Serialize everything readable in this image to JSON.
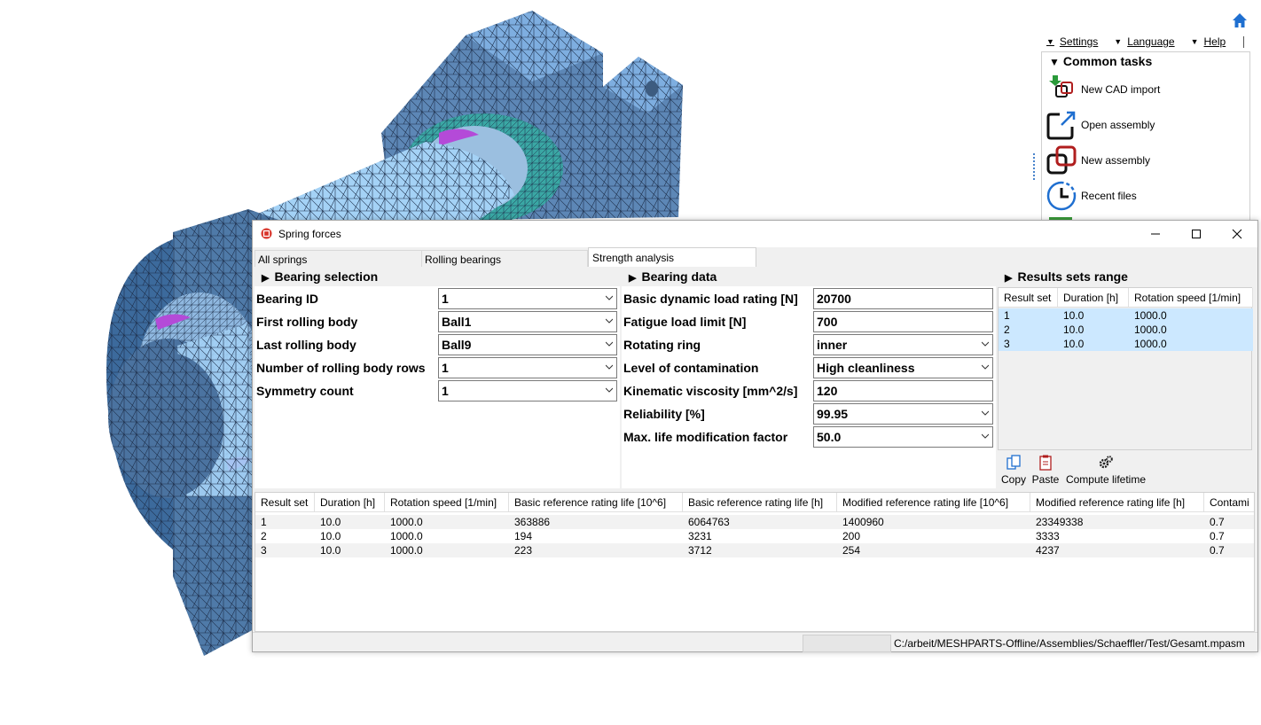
{
  "menubar": {
    "settings": "Settings",
    "language": "Language",
    "help": "Help"
  },
  "common_tasks": {
    "title": "Common tasks",
    "items": [
      "New CAD import",
      "Open assembly",
      "New assembly",
      "Recent files"
    ]
  },
  "dialog": {
    "title": "Spring forces",
    "tabs": [
      "All springs",
      "Rolling bearings",
      "Strength analysis"
    ],
    "bearing_selection": {
      "title": "Bearing selection",
      "fields": [
        {
          "label": "Bearing ID",
          "value": "1"
        },
        {
          "label": "First rolling body",
          "value": "Ball1"
        },
        {
          "label": "Last rolling body",
          "value": "Ball9"
        },
        {
          "label": "Number of rolling body rows",
          "value": "1"
        },
        {
          "label": "Symmetry count",
          "value": "1"
        }
      ]
    },
    "bearing_data": {
      "title": "Bearing data",
      "fields": [
        {
          "label": "Basic dynamic load rating [N]",
          "value": "20700"
        },
        {
          "label": "Fatigue load limit [N]",
          "value": "700"
        },
        {
          "label": "Rotating ring",
          "value": "inner"
        },
        {
          "label": "Level of contamination",
          "value": "High cleanliness"
        },
        {
          "label": "Kinematic viscosity [mm^2/s]",
          "value": "120"
        },
        {
          "label": "Reliability [%]",
          "value": "99.95"
        },
        {
          "label": "Max. life modification factor",
          "value": "50.0"
        }
      ]
    },
    "results_range": {
      "title": "Results sets range",
      "headers": [
        "Result set",
        "Duration [h]",
        "Rotation speed [1/min]"
      ],
      "rows": [
        [
          "1",
          "10.0",
          "1000.0"
        ],
        [
          "2",
          "10.0",
          "1000.0"
        ],
        [
          "3",
          "10.0",
          "1000.0"
        ]
      ]
    },
    "actions": {
      "copy": "Copy",
      "paste": "Paste",
      "compute": "Compute lifetime"
    },
    "results": {
      "headers": [
        "Result set",
        "Duration [h]",
        "Rotation speed [1/min]",
        "Basic reference rating life [10^6]",
        "Basic reference rating life [h]",
        "Modified reference rating life [10^6]",
        "Modified reference rating life [h]",
        "Contami"
      ],
      "rows": [
        [
          "1",
          "10.0",
          "1000.0",
          "363886",
          "6064763",
          "1400960",
          "23349338",
          "0.7"
        ],
        [
          "2",
          "10.0",
          "1000.0",
          "194",
          "3231",
          "200",
          "3333",
          "0.7"
        ],
        [
          "3",
          "10.0",
          "1000.0",
          "223",
          "3712",
          "254",
          "4237",
          "0.7"
        ]
      ]
    },
    "status_path": "C:/arbeit/MESHPARTS-Offline/Assemblies/Schaeffler/Test/Gesamt.mpasm"
  }
}
